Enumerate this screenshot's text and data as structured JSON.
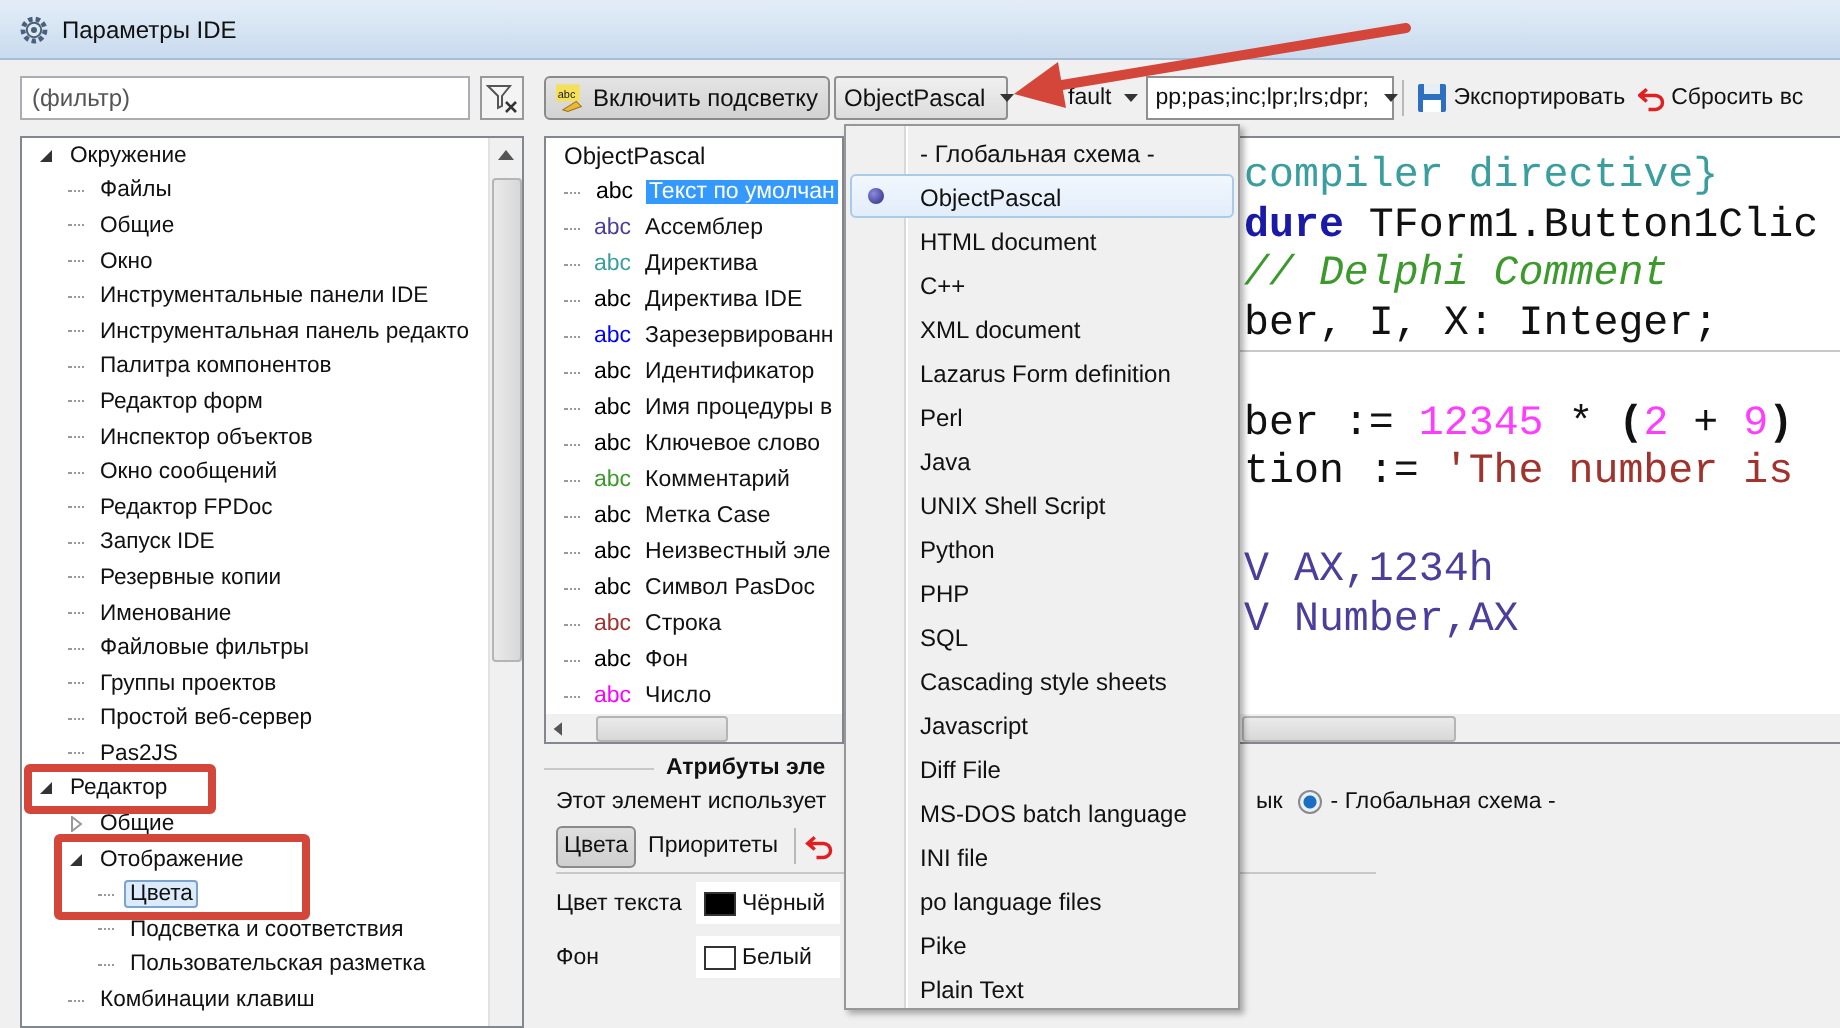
{
  "window": {
    "title": "Параметры IDE"
  },
  "filter": {
    "placeholder": "(фильтр)"
  },
  "tree": [
    {
      "label": "Окружение",
      "expanded": true,
      "selected": false,
      "children": [
        {
          "label": "Файлы",
          "selected": false
        },
        {
          "label": "Общие",
          "selected": false
        },
        {
          "label": "Окно",
          "selected": false
        },
        {
          "label": "Инструментальные панели IDE",
          "selected": false
        },
        {
          "label": "Инструментальная панель редакто",
          "selected": false
        },
        {
          "label": "Палитра компонентов",
          "selected": false
        },
        {
          "label": "Редактор форм",
          "selected": false
        },
        {
          "label": "Инспектор объектов",
          "selected": false
        },
        {
          "label": "Окно сообщений",
          "selected": false
        },
        {
          "label": "Редактор FPDoc",
          "selected": false
        },
        {
          "label": "Запуск IDE",
          "selected": false
        },
        {
          "label": "Резервные копии",
          "selected": false
        },
        {
          "label": "Именование",
          "selected": false
        },
        {
          "label": "Файловые фильтры",
          "selected": false
        },
        {
          "label": "Группы проектов",
          "selected": false
        },
        {
          "label": "Простой веб-сервер",
          "selected": false
        },
        {
          "label": "Pas2JS",
          "selected": false
        }
      ]
    },
    {
      "label": "Редактор",
      "expanded": true,
      "selected": false,
      "children": [
        {
          "label": "Общие",
          "expanded": false,
          "selected": false
        },
        {
          "label": "Отображение",
          "expanded": true,
          "selected": false,
          "children": [
            {
              "label": "Цвета",
              "selected": true
            },
            {
              "label": "Подсветка и соответствия",
              "selected": false
            },
            {
              "label": "Пользовательская разметка",
              "selected": false
            }
          ]
        },
        {
          "label": "Комбинации клавиш",
          "selected": false
        }
      ]
    }
  ],
  "toolbar": {
    "highlight_icon": "abc",
    "highlight_button": "Включить подсветку",
    "language_combo": "ObjectPascal",
    "scheme_combo": "fault",
    "extensions_combo": "pp;pas;inc;lpr;lrs;dpr;",
    "export_button": "Экспортировать",
    "reset_button": "Сбросить вс"
  },
  "elements": {
    "header": "ObjectPascal",
    "items": [
      {
        "icon": "abc",
        "label": "Текст по умолчан",
        "color": "#000000",
        "selected": true
      },
      {
        "icon": "abc",
        "label": "Ассемблер",
        "color": "#4b3f9b",
        "selected": false
      },
      {
        "icon": "abc",
        "label": "Директива",
        "color": "#3a9e9e",
        "selected": false
      },
      {
        "icon": "abc",
        "label": "Директива IDE",
        "color": "#000000",
        "selected": false
      },
      {
        "icon": "abc",
        "label": "Зарезервированн",
        "color": "#0000ff",
        "selected": false
      },
      {
        "icon": "abc",
        "label": "Идентификатор",
        "color": "#000000",
        "selected": false
      },
      {
        "icon": "abc",
        "label": "Имя процедуры в",
        "color": "#000000",
        "selected": false
      },
      {
        "icon": "abc",
        "label": "Ключевое слово",
        "color": "#000000",
        "selected": false
      },
      {
        "icon": "abc",
        "label": "Комментарий",
        "color": "#3c9a2c",
        "selected": false
      },
      {
        "icon": "abc",
        "label": "Метка Case",
        "color": "#000000",
        "selected": false
      },
      {
        "icon": "abc",
        "label": "Неизвестный эле",
        "color": "#000000",
        "selected": false
      },
      {
        "icon": "abc",
        "label": "Символ PasDoc",
        "color": "#000000",
        "selected": false
      },
      {
        "icon": "abc",
        "label": "Строка",
        "color": "#a0332e",
        "selected": false
      },
      {
        "icon": "abc",
        "label": "Фон",
        "color": "#000000",
        "selected": false
      },
      {
        "icon": "abc",
        "label": "Число",
        "color": "#ff00ff",
        "selected": false
      }
    ]
  },
  "preview": {
    "lines": [
      {
        "kind": "text",
        "tokens": [
          {
            "text": "compiler directive}",
            "kind": "directive"
          }
        ]
      },
      {
        "kind": "text",
        "tokens": [
          {
            "text": "dure",
            "kind": "keyword"
          },
          {
            "text": " TForm1.Button1Clic",
            "kind": "plain"
          }
        ]
      },
      {
        "kind": "text",
        "tokens": [
          {
            "text": "// Delphi Comment",
            "kind": "comment"
          }
        ]
      },
      {
        "kind": "text",
        "tokens": [
          {
            "text": "ber, I, X: Integer;",
            "kind": "plain"
          }
        ]
      },
      {
        "kind": "rule"
      },
      {
        "kind": "blank"
      },
      {
        "kind": "text",
        "tokens": [
          {
            "text": "ber := ",
            "kind": "plain"
          },
          {
            "text": "12345",
            "kind": "number"
          },
          {
            "text": " * ",
            "kind": "plain"
          },
          {
            "text": "(",
            "kind": "symbol"
          },
          {
            "text": "2",
            "kind": "number"
          },
          {
            "text": " + ",
            "kind": "plain"
          },
          {
            "text": "9",
            "kind": "number"
          },
          {
            "text": ")",
            "kind": "symbol"
          }
        ]
      },
      {
        "kind": "text",
        "tokens": [
          {
            "text": "tion := ",
            "kind": "plain"
          },
          {
            "text": "'The number is",
            "kind": "string"
          }
        ]
      },
      {
        "kind": "blank"
      },
      {
        "kind": "text",
        "tokens": [
          {
            "text": "V AX,1234h",
            "kind": "asm"
          }
        ]
      },
      {
        "kind": "text",
        "tokens": [
          {
            "text": "V Number,AX",
            "kind": "asm"
          }
        ]
      }
    ]
  },
  "language_menu": {
    "items": [
      {
        "label": "- Глобальная схема -",
        "selected": false
      },
      {
        "label": "ObjectPascal",
        "selected": true
      },
      {
        "label": "HTML document",
        "selected": false
      },
      {
        "label": "C++",
        "selected": false
      },
      {
        "label": "XML document",
        "selected": false
      },
      {
        "label": "Lazarus Form definition",
        "selected": false
      },
      {
        "label": "Perl",
        "selected": false
      },
      {
        "label": "Java",
        "selected": false
      },
      {
        "label": "UNIX Shell Script",
        "selected": false
      },
      {
        "label": "Python",
        "selected": false
      },
      {
        "label": "PHP",
        "selected": false
      },
      {
        "label": "SQL",
        "selected": false
      },
      {
        "label": "Cascading style sheets",
        "selected": false
      },
      {
        "label": "Javascript",
        "selected": false
      },
      {
        "label": "Diff File",
        "selected": false
      },
      {
        "label": "MS-DOS batch language",
        "selected": false
      },
      {
        "label": "INI file",
        "selected": false
      },
      {
        "label": "po language files",
        "selected": false
      },
      {
        "label": "Pike",
        "selected": false
      },
      {
        "label": "Plain Text",
        "selected": false
      }
    ]
  },
  "attributes": {
    "title": "Атрибуты эле",
    "note": "Этот элемент использует",
    "note_tail": "ык",
    "scheme_option": {
      "label": "- Глобальная схема -",
      "checked": true
    },
    "tabs": [
      {
        "label": "Цвета",
        "selected": true
      },
      {
        "label": "Приоритеты",
        "selected": false
      }
    ],
    "fields": [
      {
        "label": "Цвет текста",
        "value": "Чёрный",
        "color": "#000000"
      },
      {
        "label": "Фон",
        "value": "Белый",
        "color": "#ffffff"
      }
    ]
  }
}
